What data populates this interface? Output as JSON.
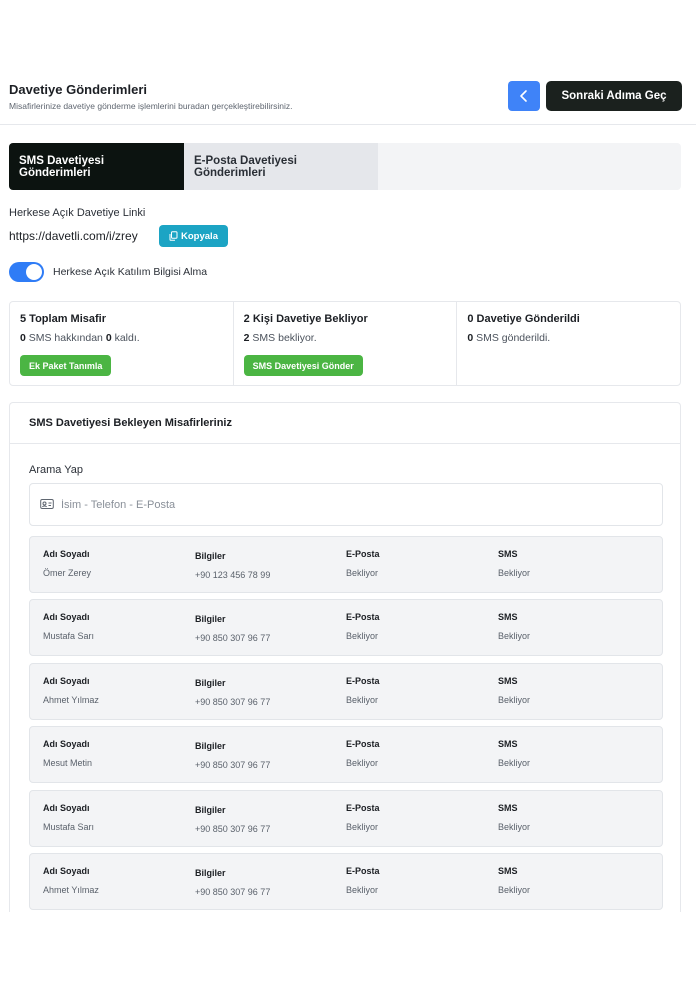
{
  "header": {
    "title": "Davetiye Gönderimleri",
    "subtitle": "Misafirlerinize davetiye gönderme işlemlerini buradan gerçekleştirebilirsiniz.",
    "back_icon": "chevron-left-icon",
    "next_label": "Sonraki Adıma Geç"
  },
  "tabs": [
    {
      "label": "SMS Davetiyesi Gönderimleri",
      "active": true
    },
    {
      "label": "E-Posta Davetiyesi Gönderimleri",
      "active": false
    }
  ],
  "public_link": {
    "label": "Herkese Açık Davetiye Linki",
    "url": "https://davetli.com/i/zrey",
    "copy_label": "Kopyala",
    "copy_icon": "copy-icon"
  },
  "toggle": {
    "label": "Herkese Açık Katılım Bilgisi Alma",
    "on": true
  },
  "stats": [
    {
      "count": "5",
      "title": " Toplam Misafir",
      "sub_a": "0",
      "sub_mid": " SMS hakkından ",
      "sub_b": "0",
      "sub_end": " kaldı.",
      "button": "Ek Paket Tanımla"
    },
    {
      "count": "2",
      "title": " Kişi Davetiye Bekliyor",
      "sub_a": "2",
      "sub_mid": " SMS bekliyor.",
      "button": "SMS Davetiyesi Gönder"
    },
    {
      "count": "0",
      "title": " Davetiye Gönderildi",
      "sub_a": "0",
      "sub_mid": " SMS gönderildi."
    }
  ],
  "guests": {
    "title": "SMS Davetiyesi Bekleyen Misafirleriniz",
    "search_label": "Arama Yap",
    "search_placeholder": "İsim - Telefon - E-Posta",
    "columns": {
      "name": "Adı Soyadı",
      "info": "Bilgiler",
      "email": "E-Posta",
      "sms": "SMS"
    },
    "rows": [
      {
        "name": "Ömer Zerey",
        "phone": "+90 123 456 78 99",
        "email": "Bekliyor",
        "sms": "Bekliyor"
      },
      {
        "name": "Mustafa Sarı",
        "phone": "+90 850 307 96 77",
        "email": "Bekliyor",
        "sms": "Bekliyor"
      },
      {
        "name": "Ahmet Yılmaz",
        "phone": "+90 850 307 96 77",
        "email": "Bekliyor",
        "sms": "Bekliyor"
      },
      {
        "name": "Mesut Metin",
        "phone": "+90 850 307 96 77",
        "email": "Bekliyor",
        "sms": "Bekliyor"
      },
      {
        "name": "Mustafa Sarı",
        "phone": "+90 850 307 96 77",
        "email": "Bekliyor",
        "sms": "Bekliyor"
      },
      {
        "name": "Ahmet Yılmaz",
        "phone": "+90 850 307 96 77",
        "email": "Bekliyor",
        "sms": "Bekliyor"
      }
    ]
  },
  "colors": {
    "primary_blue": "#3f83f8",
    "dark": "#1b211e",
    "teal": "#1ca4c4",
    "green": "#4bb543"
  }
}
